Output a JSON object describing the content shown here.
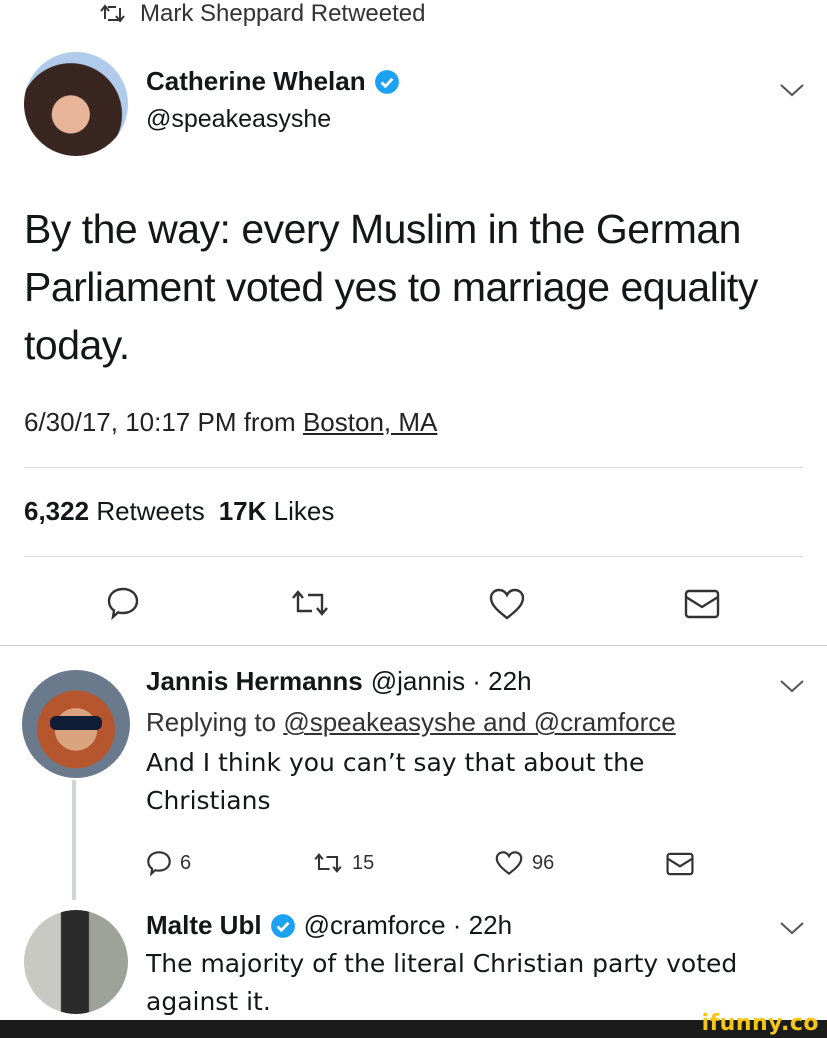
{
  "retweet_header": {
    "text": "Mark Sheppard Retweeted"
  },
  "main_tweet": {
    "display_name": "Catherine Whelan",
    "handle": "@speakeasyshe",
    "text": "By the way: every Muslim in the German Parliament voted yes to marriage equality today.",
    "timestamp": "6/30/17, 10:17 PM from",
    "location": "Boston, MA",
    "retweets_count": "6,322",
    "retweets_label": "Retweets",
    "likes_count": "17K",
    "likes_label": "Likes"
  },
  "reply1": {
    "display_name": "Jannis Hermanns",
    "meta": "@jannis · 22h",
    "replying_prefix": "Replying to",
    "replying_mentions": "@speakeasyshe and @cramforce",
    "text_line1": "And I think you can’t say that about the",
    "text_line2": "Christians",
    "reply_count": "6",
    "retweet_count": "15",
    "like_count": "96"
  },
  "reply2": {
    "display_name": "Malte Ubl",
    "meta": "@cramforce · 22h",
    "text_line1": "The majority of the literal Christian party voted",
    "text_line2": "against it."
  },
  "watermark": "ifunny.co",
  "colors": {
    "verified": "#1da1f2",
    "divider": "#d9dde0",
    "watermark": "#f5c518"
  }
}
